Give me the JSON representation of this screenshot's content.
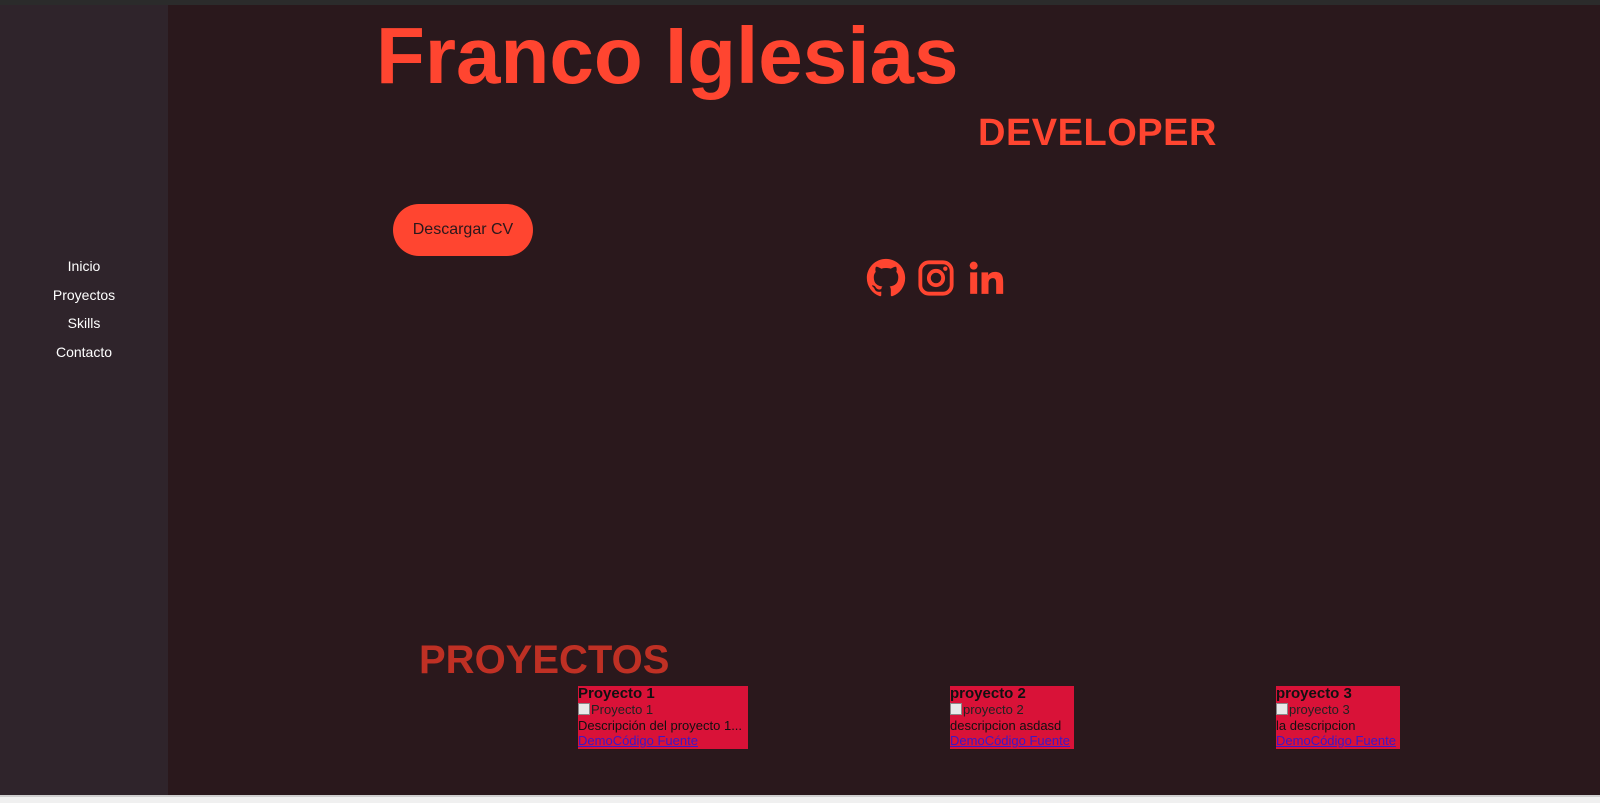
{
  "sidebar": {
    "nav": [
      "Inicio",
      "Proyectos",
      "Skills",
      "Contacto"
    ]
  },
  "hero": {
    "name": "Franco Iglesias",
    "role": "DEVELOPER",
    "cv_button": "Descargar CV",
    "socials": [
      "github-icon",
      "instagram-icon",
      "linkedin-icon"
    ]
  },
  "projects": {
    "heading": "PROYECTOS",
    "items": [
      {
        "title": "Proyecto 1",
        "image_alt": "Proyecto 1",
        "description": "Descripción del proyecto 1...",
        "demo": "Demo",
        "code": "Código Fuente"
      },
      {
        "title": "proyecto 2",
        "image_alt": "proyecto 2",
        "description": "descripcion asdasd",
        "demo": "Demo",
        "code": "Código Fuente"
      },
      {
        "title": "proyecto 3",
        "image_alt": "proyecto 3",
        "description": "la descripcion",
        "demo": "Demo",
        "code": "Código Fuente"
      }
    ]
  },
  "colors": {
    "background": "#2a181c",
    "sidebar": "#2f242b",
    "accent": "#ff4530",
    "section_title": "#bf3024",
    "card": "#d91238"
  }
}
